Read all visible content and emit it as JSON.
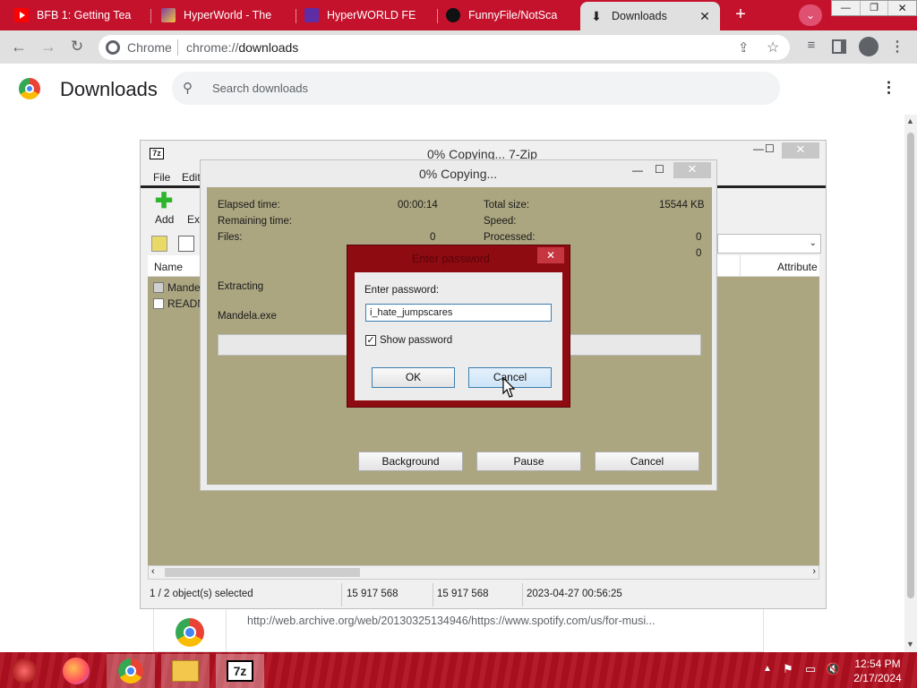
{
  "tabs": [
    {
      "label": "BFB 1: Getting Tea",
      "fav": "youtube-icon",
      "fav_color": "#ff0000"
    },
    {
      "label": "HyperWorld - The",
      "fav": "cursor-icon",
      "fav_color": "#7b3fa0"
    },
    {
      "label": "HyperWORLD FE",
      "fav": "hyper-icon",
      "fav_color": "#5e2ca5"
    },
    {
      "label": "FunnyFile/NotSca",
      "fav": "github-icon",
      "fav_color": "#111111"
    },
    {
      "label": "Downloads",
      "fav": "download-icon",
      "fav_color": "#202124",
      "active": true
    }
  ],
  "omnibox": {
    "site_label": "Chrome",
    "url_prefix": "chrome://",
    "url_bold": "downloads"
  },
  "downloads_page": {
    "title": "Downloads",
    "search_placeholder": "Search downloads",
    "item_url": "http://web.archive.org/web/20130325134946/https://www.spotify.com/us/for-musi..."
  },
  "zip_main": {
    "title": "0% Copying... 7-Zip",
    "menu": [
      "File",
      "Edit"
    ],
    "toolbar": [
      {
        "label": "Add"
      },
      {
        "label": "Ext"
      }
    ],
    "columns": {
      "name": "Name",
      "attributes": "Attribute"
    },
    "files": [
      "Mande",
      "READN"
    ],
    "status": {
      "selected": "1 / 2 object(s) selected",
      "size1": "15 917 568",
      "size2": "15 917 568",
      "date": "2023-04-27 00:56:25"
    }
  },
  "progress": {
    "title": "0% Copying...",
    "elapsed_label": "Elapsed time:",
    "elapsed_value": "00:00:14",
    "remaining_label": "Remaining time:",
    "files_label": "Files:",
    "files_value": "0",
    "total_label": "Total size:",
    "total_value": "15544 KB",
    "speed_label": "Speed:",
    "processed_label": "Processed:",
    "processed_value": "0",
    "extra_value": "0",
    "action": "Extracting",
    "current_file": "Mandela.exe",
    "buttons": {
      "background": "Background",
      "pause": "Pause",
      "cancel": "Cancel"
    }
  },
  "password": {
    "title": "Enter password",
    "prompt": "Enter password:",
    "value": "i_hate_jumpscares",
    "show_label": "Show password",
    "ok": "OK",
    "cancel": "Cancel"
  },
  "taskbar": {
    "time": "12:54 PM",
    "date": "2/17/2024",
    "zip_label": "7z"
  }
}
